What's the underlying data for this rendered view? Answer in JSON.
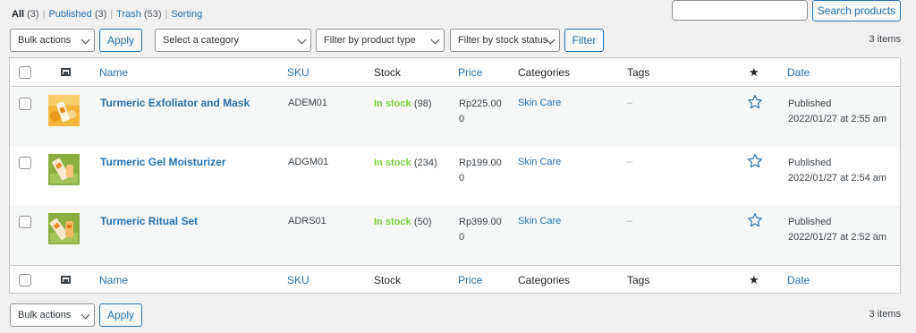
{
  "views": {
    "all": {
      "label": "All",
      "count": "(3)"
    },
    "published": {
      "label": "Published",
      "count": "(3)"
    },
    "trash": {
      "label": "Trash",
      "count": "(53)"
    },
    "sorting": {
      "label": "Sorting"
    },
    "separator": "|"
  },
  "search": {
    "value": "",
    "button": "Search products"
  },
  "filters": {
    "bulk_actions": "Bulk actions",
    "apply": "Apply",
    "category": "Select a category",
    "product_type": "Filter by product type",
    "stock_status": "Filter by stock status",
    "filter": "Filter",
    "items_count": "3 items"
  },
  "columns": {
    "name": "Name",
    "sku": "SKU",
    "stock": "Stock",
    "price": "Price",
    "categories": "Categories",
    "tags": "Tags",
    "date": "Date"
  },
  "products": [
    {
      "name": "Turmeric Exfoliator and Mask",
      "sku": "ADEM01",
      "stock_status": "In stock",
      "stock_qty": "(98)",
      "price_line1": "Rp225.00",
      "price_line2": "0",
      "category": "Skin Care",
      "tags": "–",
      "date_status": "Published",
      "date_value": "2022/01/27 at 2:55 am"
    },
    {
      "name": "Turmeric Gel Moisturizer",
      "sku": "ADGM01",
      "stock_status": "In stock",
      "stock_qty": "(234)",
      "price_line1": "Rp199.00",
      "price_line2": "0",
      "category": "Skin Care",
      "tags": "–",
      "date_status": "Published",
      "date_value": "2022/01/27 at 2:54 am"
    },
    {
      "name": "Turmeric Ritual Set",
      "sku": "ADRS01",
      "stock_status": "In stock",
      "stock_qty": "(50)",
      "price_line1": "Rp399.00",
      "price_line2": "0",
      "category": "Skin Care",
      "tags": "–",
      "date_status": "Published",
      "date_value": "2022/01/27 at 2:52 am"
    }
  ],
  "icons": {
    "image_column": "image-icon",
    "featured_column": "star-filled-icon",
    "featured_toggle": "star-outline-icon",
    "dropdown": "chevron-down-icon"
  },
  "colors": {
    "link": "#2271b1",
    "in_stock": "#7ad03a",
    "page_bg": "#f0f0f1",
    "border": "#c3c4c7"
  }
}
